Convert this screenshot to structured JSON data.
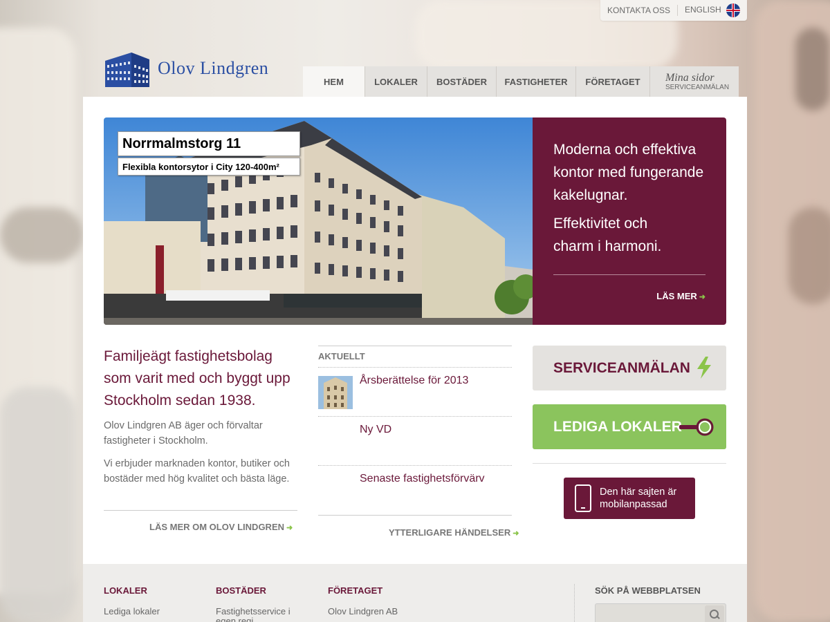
{
  "topbar": {
    "contact": "KONTAKTA OSS",
    "language": "ENGLISH"
  },
  "logo": {
    "text": "Olov Lindgren"
  },
  "nav": {
    "tabs": [
      "HEM",
      "LOKALER",
      "BOSTÄDER",
      "FASTIGHETER",
      "FÖRETAGET"
    ],
    "mina_title": "Mina sidor",
    "mina_sub": "SERVICEANMÄLAN"
  },
  "hero": {
    "tag_title": "Norrmalmstorg 11",
    "tag_sub": "Flexibla kontorsytor i City 120-400m²",
    "text1": "Moderna och effektiva kontor med fungerande kakelugnar.",
    "text2": "Effektivitet och charm i harmoni.",
    "more": "LÄS MER"
  },
  "intro": {
    "title": "Familjeägt fastighetsbolag som varit med och byggt upp Stockholm sedan 1938.",
    "p1": "Olov Lindgren AB äger och förvaltar fastigheter i Stockholm.",
    "p2": "Vi erbjuder marknaden kontor, butiker och bostäder med hög kvalitet och bästa läge.",
    "more": "LÄS MER OM OLOV LINDGREN"
  },
  "news": {
    "heading": "AKTUELLT",
    "items": [
      "Årsberättelse för 2013",
      "Ny VD",
      "Senaste fastighetsförvärv"
    ],
    "more": "YTTERLIGARE HÄNDELSER"
  },
  "actions": {
    "service": "SERVICEANMÄLAN",
    "lediga": "LEDIGA LOKALER",
    "mobile": "Den här sajten är mobilanpassad"
  },
  "footer": {
    "col1_head": "LOKALER",
    "col1_link": "Lediga lokaler",
    "col2_head": "BOSTÄDER",
    "col2_link": "Fastighetsservice i egen regi",
    "col3_head": "FÖRETAGET",
    "col3_link": "Olov Lindgren AB",
    "search_head": "SÖK PÅ WEBBPLATSEN",
    "search_placeholder": ""
  },
  "colors": {
    "brand": "#6a1839",
    "green": "#8bc45d",
    "logo_blue": "#2b4fa3"
  }
}
